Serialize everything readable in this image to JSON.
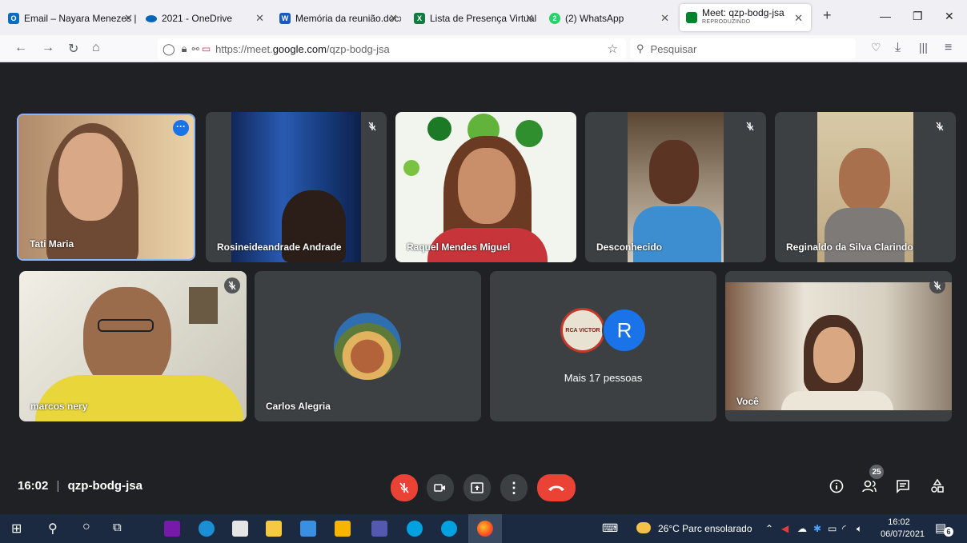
{
  "browser": {
    "tabs": [
      {
        "label": "Email – Nayara Menezes |",
        "close": "✕",
        "fav_color": "#0f6cbd",
        "fav_text": "O"
      },
      {
        "label": "2021 - OneDrive",
        "close": "✕",
        "fav_color": "#0364b8",
        "fav_text": ""
      },
      {
        "label": "Memória da reunião.docx",
        "close": "✕",
        "fav_color": "#185abd",
        "fav_text": "W"
      },
      {
        "label": "Lista de Presença Virtual |",
        "close": "✕",
        "fav_color": "#107c41",
        "fav_text": "X"
      },
      {
        "label": "(2) WhatsApp",
        "close": "✕",
        "fav_color": "#25d366",
        "fav_text": "2"
      },
      {
        "label": "Meet: qzp-bodg-jsa",
        "sublabel": "REPRODUZINDO",
        "close": "✕",
        "fav_color": "#00832d",
        "fav_text": ""
      }
    ],
    "new_tab": "+",
    "window_controls": {
      "minimize": "—",
      "restore": "❐",
      "close": "✕"
    },
    "url_prefix": "https://meet.",
    "url_domain": "google.com",
    "url_path": "/qzp-bodg-jsa",
    "search_placeholder": "Pesquisar"
  },
  "participants": [
    {
      "name": "Tati Maria",
      "muted": false,
      "active_speaker": true,
      "bg": "#c9a27a"
    },
    {
      "name": "Rosineideandrade Andrade",
      "muted": true,
      "bg": "#1e3f78"
    },
    {
      "name": "Raquel Mendes Miguel",
      "muted": false,
      "bg": "#e9efe3"
    },
    {
      "name": "Desconhecido",
      "muted": true,
      "bg": "#8a7f6e"
    },
    {
      "name": "Reginaldo da Silva Clarindo",
      "muted": true,
      "bg": "#c9b99a"
    },
    {
      "name": "marcos nery",
      "muted": true,
      "bg": "#d9d6c7"
    },
    {
      "name": "Carlos Alegria",
      "muted": false,
      "bg": "#3c4043"
    },
    {
      "name": "Mais 17 pessoas",
      "muted": false,
      "avatar_letter": "R",
      "avatar_logo": "RCA VICTOR",
      "bg": "#3c4043"
    },
    {
      "name": "Você",
      "muted": true,
      "bg": "#b5a895"
    }
  ],
  "meeting": {
    "time": "16:02",
    "separator": "|",
    "code": "qzp-bodg-jsa",
    "participant_count": "25"
  },
  "taskbar": {
    "weather": "26°C  Parc ensolarado",
    "clock_time": "16:02",
    "clock_date": "06/07/2021",
    "notification_count": "6"
  },
  "colors": {
    "meet_bg": "#202124",
    "tile_bg": "#3c4043",
    "mic_off_red": "#ea4335",
    "hangup_red": "#ea4335",
    "avatar_blue": "#1a73e8",
    "active_border": "#8ab4f8"
  }
}
